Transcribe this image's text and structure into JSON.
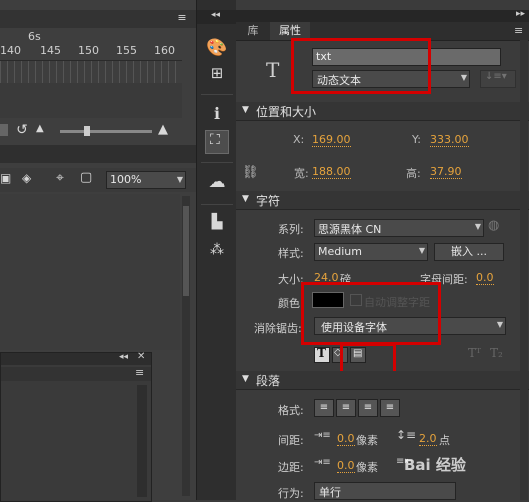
{
  "timeline": {
    "time_label": "6s",
    "frame_numbers": [
      "140",
      "145",
      "150",
      "155",
      "160"
    ],
    "zoom_value": "100%"
  },
  "properties_panel": {
    "tabs": [
      "库",
      "属性"
    ],
    "instance_name": "txt",
    "text_type": "动态文本",
    "sections": {
      "position_size": "位置和大小",
      "character": "字符",
      "paragraph": "段落"
    },
    "position": {
      "x_label": "X:",
      "x": "169.00",
      "y_label": "Y:",
      "y": "333.00"
    },
    "size": {
      "w_label": "宽:",
      "w": "188.00",
      "h_label": "高:",
      "h": "37.90"
    },
    "character": {
      "family_label": "系列:",
      "family": "思源黑体 CN",
      "style_label": "样式:",
      "style": "Medium",
      "embed_button": "嵌入 ...",
      "size_label": "大小:",
      "size": "24.0",
      "size_unit": "磅",
      "letter_spacing_label": "字母间距:",
      "letter_spacing": "0.0",
      "color_label": "颜色:",
      "auto_kern": "自动调整字距",
      "antialias_label": "消除锯齿:",
      "antialias": "使用设备字体"
    },
    "paragraph": {
      "format_label": "格式:",
      "spacing_label": "间距:",
      "indent_value": "0.0",
      "indent_unit": "像素",
      "line_spacing": "2.0",
      "line_unit": "点",
      "margin_label": "边距:",
      "margin_left": "0.0",
      "margin_unit": "像素",
      "behavior_label": "行为:",
      "behavior": "单行"
    }
  },
  "watermark": "Bai 经验"
}
